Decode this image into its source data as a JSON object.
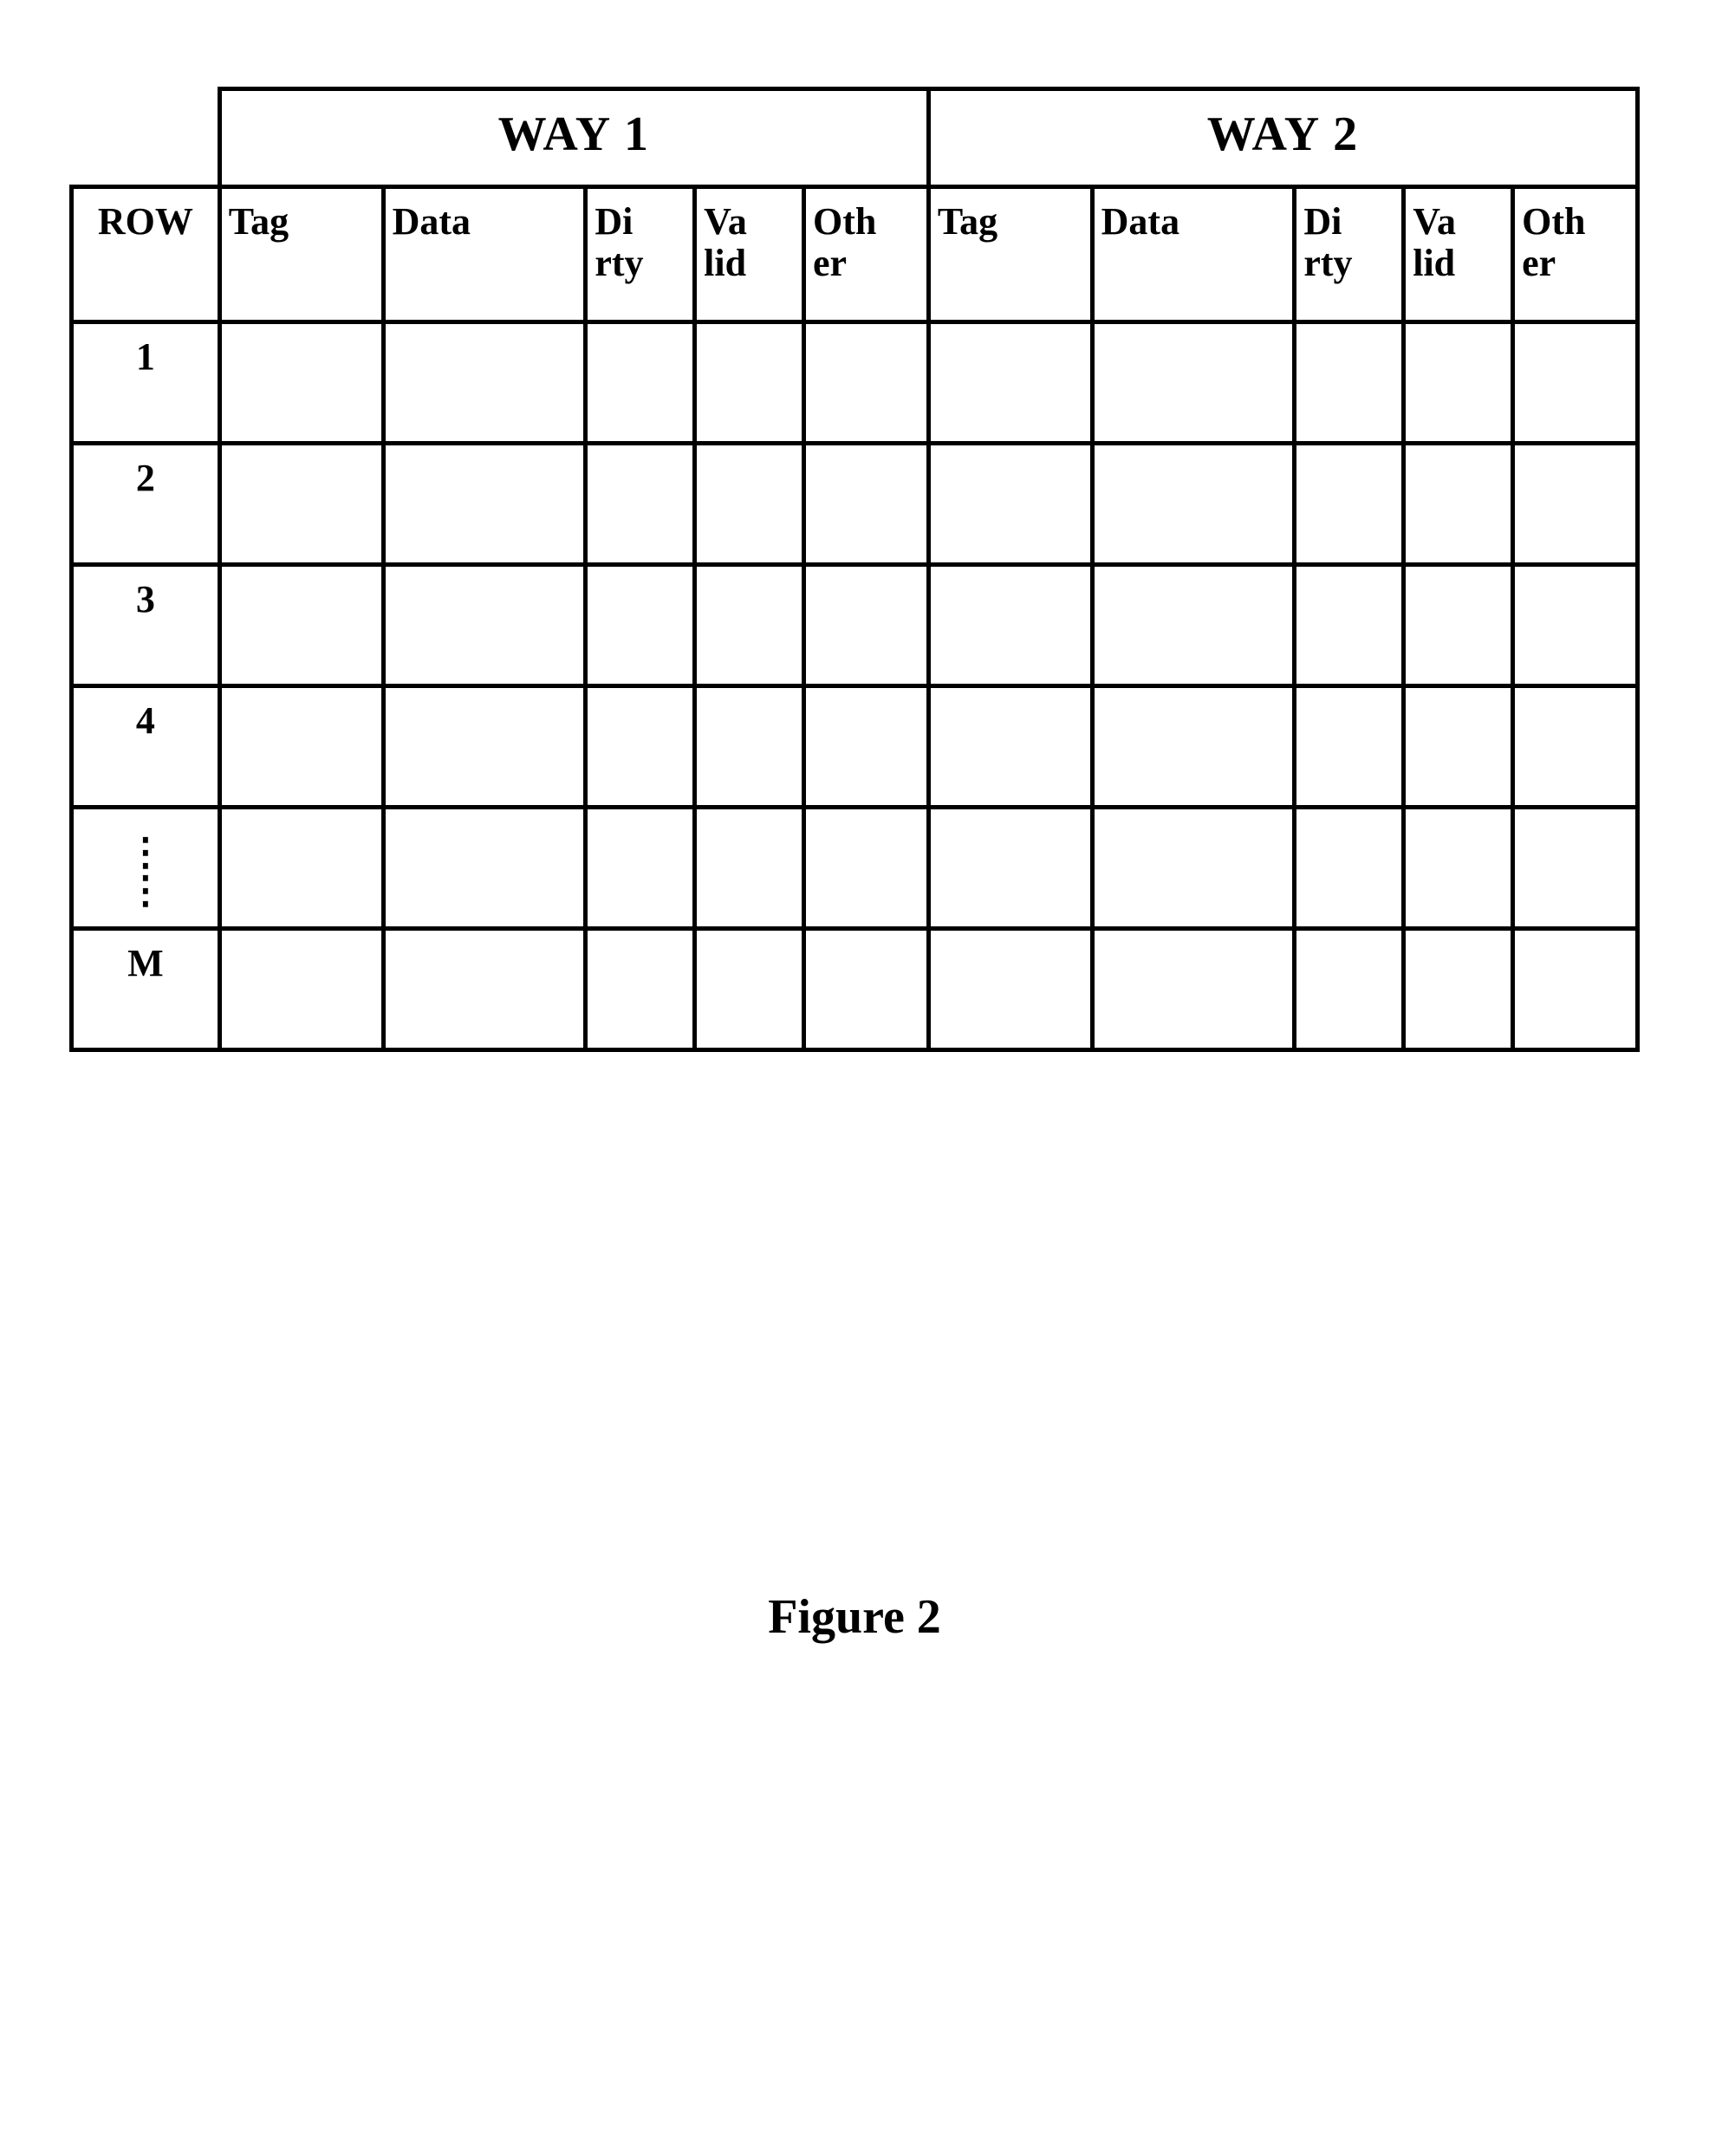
{
  "caption": "Figure 2",
  "way_headers": [
    "WAY 1",
    "WAY 2"
  ],
  "row_header": "ROW",
  "column_headers": [
    "Tag",
    "Data",
    "Di\nrty",
    "Va\nlid",
    "Oth\ner"
  ],
  "row_labels": [
    "1",
    "2",
    "3",
    "4",
    "⋮",
    "M"
  ],
  "chart_data": {
    "type": "table",
    "title": "Figure 2",
    "description": "Two-way set-associative cache structure; each way has Tag, Data, Dirty, Valid, Other columns; rows 1..M are empty placeholders.",
    "columns": [
      "ROW",
      "WAY1:Tag",
      "WAY1:Data",
      "WAY1:Dirty",
      "WAY1:Valid",
      "WAY1:Other",
      "WAY2:Tag",
      "WAY2:Data",
      "WAY2:Dirty",
      "WAY2:Valid",
      "WAY2:Other"
    ],
    "rows": [
      {
        "row": "1",
        "way1": [
          "",
          "",
          "",
          "",
          ""
        ],
        "way2": [
          "",
          "",
          "",
          "",
          ""
        ]
      },
      {
        "row": "2",
        "way1": [
          "",
          "",
          "",
          "",
          ""
        ],
        "way2": [
          "",
          "",
          "",
          "",
          ""
        ]
      },
      {
        "row": "3",
        "way1": [
          "",
          "",
          "",
          "",
          ""
        ],
        "way2": [
          "",
          "",
          "",
          "",
          ""
        ]
      },
      {
        "row": "4",
        "way1": [
          "",
          "",
          "",
          "",
          ""
        ],
        "way2": [
          "",
          "",
          "",
          "",
          ""
        ]
      },
      {
        "row": "⋮",
        "way1": [
          "",
          "",
          "",
          "",
          ""
        ],
        "way2": [
          "",
          "",
          "",
          "",
          ""
        ]
      },
      {
        "row": "M",
        "way1": [
          "",
          "",
          "",
          "",
          ""
        ],
        "way2": [
          "",
          "",
          "",
          "",
          ""
        ]
      }
    ]
  }
}
